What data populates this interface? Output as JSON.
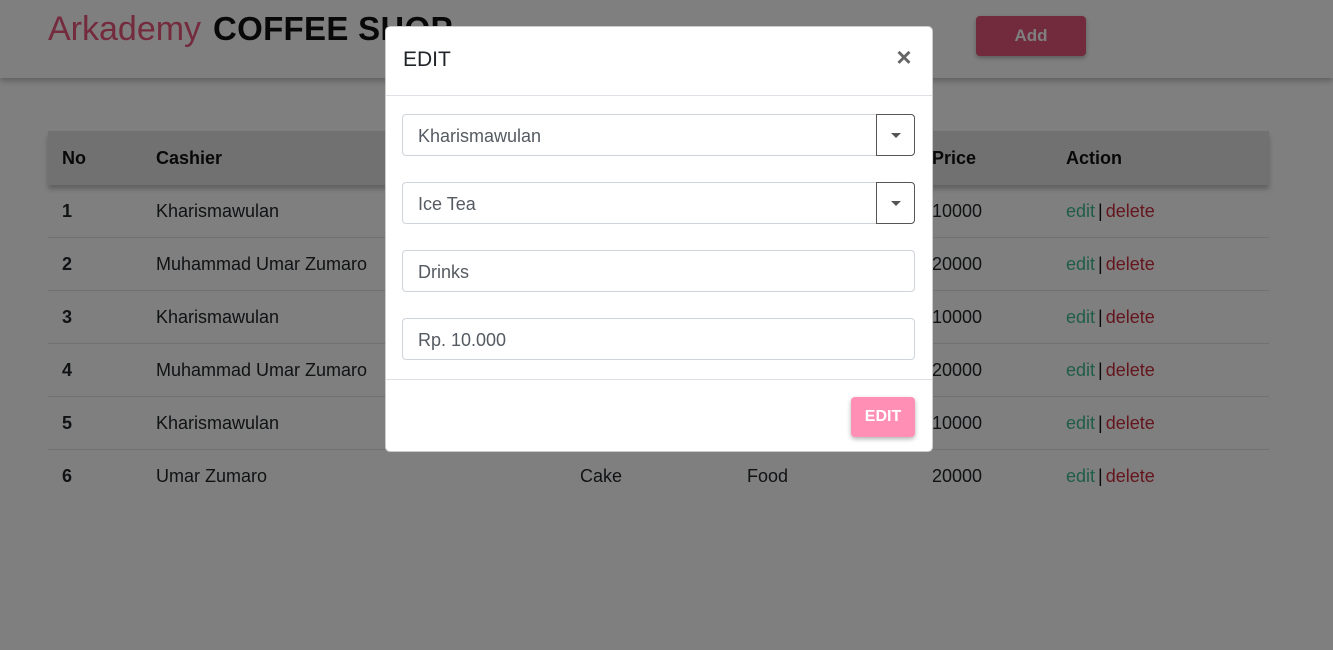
{
  "header": {
    "brand": "Arkademy",
    "shop_title": "COFFEE SHOP",
    "add_label": "Add"
  },
  "table": {
    "headers": [
      "No",
      "Cashier",
      "",
      "",
      "Price",
      "Action"
    ],
    "rows": [
      {
        "no": "1",
        "cashier": "Kharismawulan",
        "product": "",
        "category": "",
        "price": "10000"
      },
      {
        "no": "2",
        "cashier": "Muhammad Umar Zumaro",
        "product": "",
        "category": "",
        "price": "20000"
      },
      {
        "no": "3",
        "cashier": "Kharismawulan",
        "product": "",
        "category": "",
        "price": "10000"
      },
      {
        "no": "4",
        "cashier": "Muhammad Umar Zumaro",
        "product": "",
        "category": "",
        "price": "20000"
      },
      {
        "no": "5",
        "cashier": "Kharismawulan",
        "product": "",
        "category": "",
        "price": "10000"
      },
      {
        "no": "6",
        "cashier": "Umar Zumaro",
        "product": "Cake",
        "category": "Food",
        "price": "20000"
      }
    ],
    "action_edit": "edit",
    "action_sep": "|",
    "action_delete": "delete"
  },
  "modal": {
    "title": "EDIT",
    "close_symbol": "×",
    "cashier_value": "Kharismawulan",
    "product_value": "Ice Tea",
    "category_value": "Drinks",
    "price_value": "Rp. 10.000",
    "submit_label": "EDIT"
  },
  "colors": {
    "brand": "#e8577b",
    "add_button": "#e2577b",
    "edit_link": "#3fba8f",
    "delete_link": "#c92a3a",
    "modal_button": "#ff8fb4"
  }
}
